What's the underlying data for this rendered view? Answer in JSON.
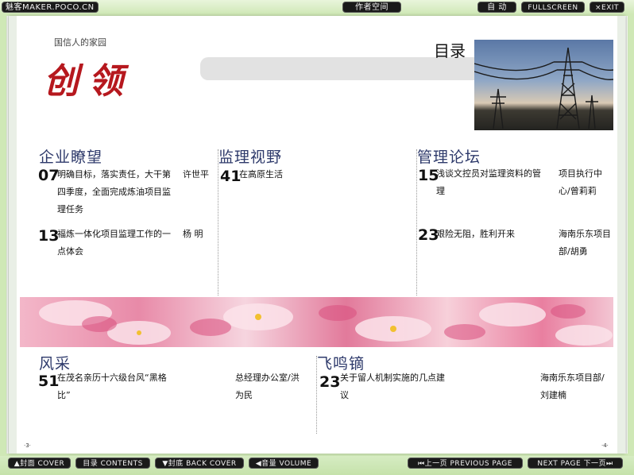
{
  "topbar": {
    "brand": "魅客MAKER.POCO.CN",
    "author_space": "作者空间",
    "auto": "自 动",
    "fullscreen": "FULLSCREEN",
    "exit": "×EXIT"
  },
  "header": {
    "slogan": "国信人的家园",
    "logo": "创领",
    "toc_title": "目录"
  },
  "sections": [
    {
      "heading": "企业瞭望",
      "entries": [
        {
          "page": "07",
          "title": "明确目标，落实责任，大干第四季度，全面完成炼油项目监理任务",
          "author": "许世平"
        },
        {
          "page": "13",
          "title": "福炼一体化项目监理工作的一点体会",
          "author": "杨 明"
        }
      ]
    },
    {
      "heading": "监理视野",
      "entries": [
        {
          "page": "41",
          "title": "在高原生活",
          "author": ""
        }
      ]
    },
    {
      "heading": "管理论坛",
      "entries": [
        {
          "page": "15",
          "title": "浅谈文控员对监理资料的管理",
          "author": "项目执行中心/曾莉莉"
        },
        {
          "page": "23",
          "title": "艰险无阻，胜利开来",
          "author": "海南乐东项目部/胡勇"
        }
      ]
    },
    {
      "heading": "风采",
      "entries": [
        {
          "page": "51",
          "title": "在茂名亲历十六级台风“黑格比”",
          "author": "总经理办公室/洪为民"
        }
      ]
    },
    {
      "heading": "飞鸣镝",
      "entries": [
        {
          "page": "23",
          "title": "关于留人机制实施的几点建议",
          "author": "海南乐东项目部/刘建楠"
        }
      ]
    }
  ],
  "page_numbers": {
    "left": "·3·",
    "right": "·4·"
  },
  "bottombar": {
    "cover": "▲封面 COVER",
    "contents": "目录 CONTENTS",
    "back_cover": "▼封底 BACK COVER",
    "volume": "◀音量 VOLUME",
    "prev": "⏮上一页 PREVIOUS PAGE",
    "next": "NEXT PAGE 下一页⏭"
  },
  "colors": {
    "background": "#cfe8b6",
    "heading": "#2e3a6b",
    "logo": "#b6181e"
  }
}
